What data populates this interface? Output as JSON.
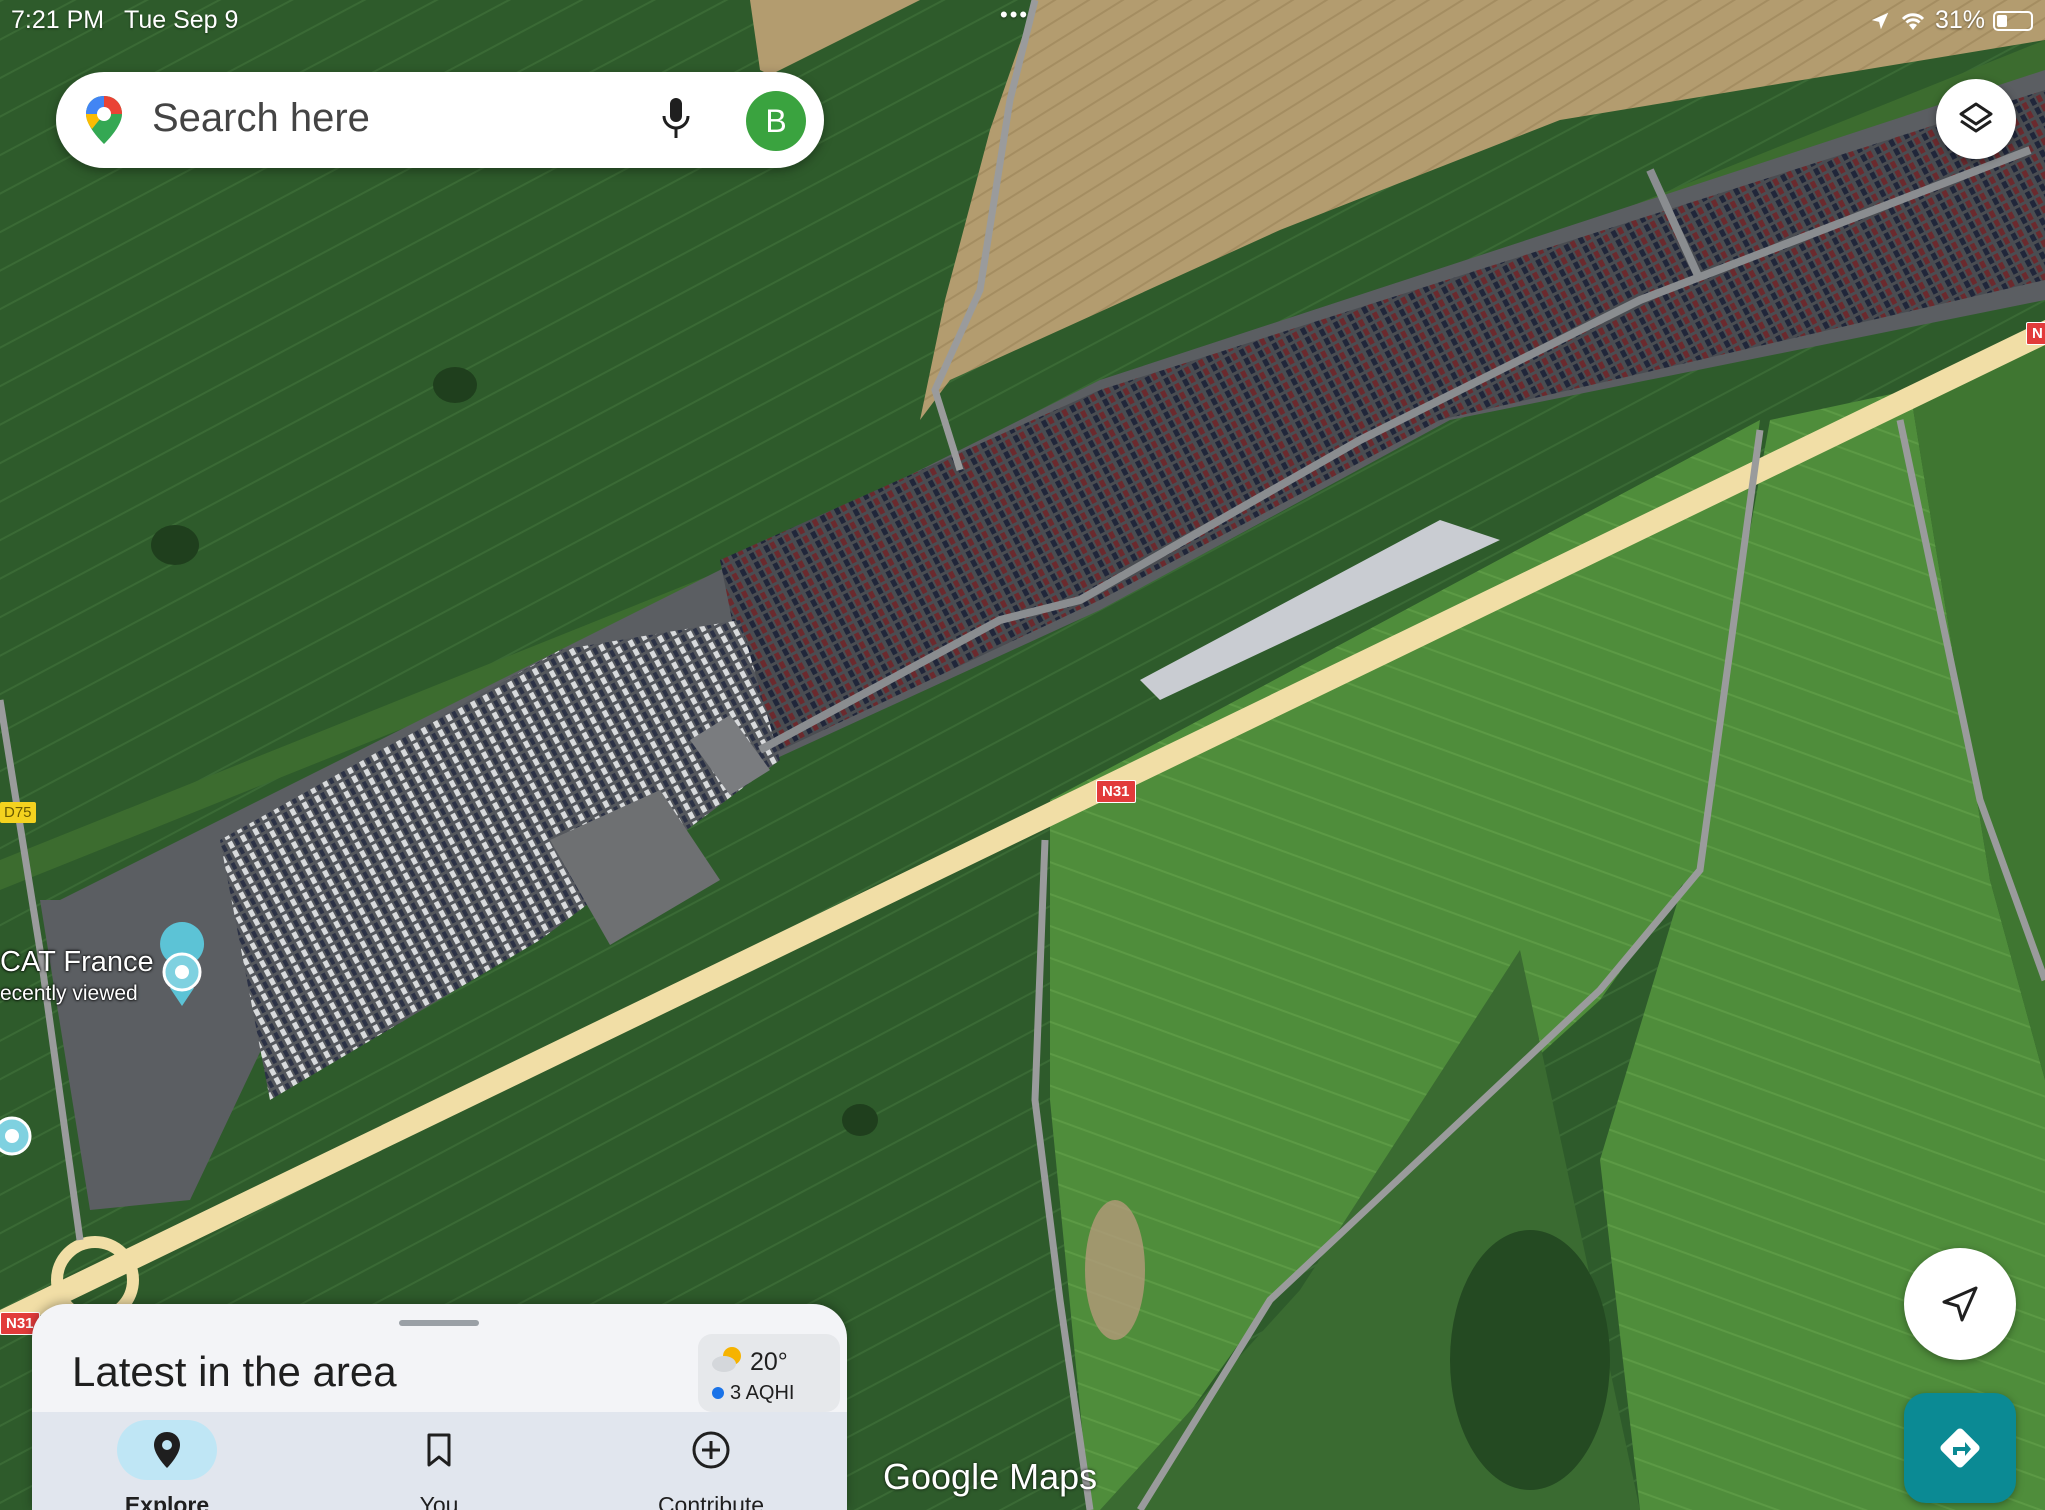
{
  "status_bar": {
    "time": "7:21 PM",
    "date": "Tue Sep 9",
    "battery": "31%",
    "battery_level": 0.31
  },
  "search": {
    "placeholder": "Search here",
    "avatar_letter": "B"
  },
  "map": {
    "type": "satellite",
    "place_label": "CAT France",
    "place_sublabel": "ecently viewed",
    "road_labels": [
      "N31",
      "N31",
      "D75",
      "N"
    ],
    "watermark": "Google Maps"
  },
  "bottom_sheet": {
    "title": "Latest in the area",
    "weather": {
      "temperature": "20°",
      "air_quality": "3 AQHI"
    },
    "nav": [
      {
        "label": "Explore",
        "icon": "location-pin-icon",
        "active": true
      },
      {
        "label": "You",
        "icon": "bookmark-icon",
        "active": false
      },
      {
        "label": "Contribute",
        "icon": "add-circle-icon",
        "active": false
      }
    ]
  },
  "colors": {
    "field_dark": "#2f5a2c",
    "field_light": "#4d8a3a",
    "wheat_field": "#b19a6c",
    "lot_asphalt": "#5b5e62",
    "highway": "#f1dea6",
    "accent_green": "#3aa33f",
    "directions_teal": "#0b8a94",
    "nav_active": "#bfe6f5"
  }
}
